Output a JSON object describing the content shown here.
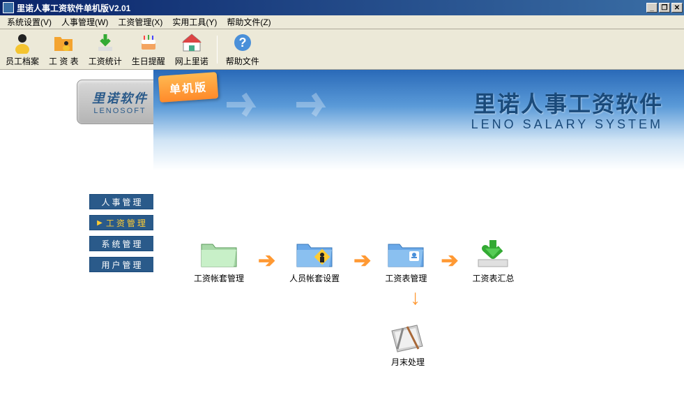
{
  "titlebar": {
    "title": "里诺人事工资软件单机版V2.01"
  },
  "menubar": {
    "items": [
      "系统设置(V)",
      "人事管理(W)",
      "工资管理(X)",
      "实用工具(Y)",
      "帮助文件(Z)"
    ]
  },
  "toolbar": {
    "items": [
      "员工档案",
      "工 资 表",
      "工资统计",
      "生日提醒",
      "网上里诺",
      "帮助文件"
    ]
  },
  "logo": {
    "cn": "里诺软件",
    "en": "LENOSOFT"
  },
  "nav": {
    "items": [
      "人事管理",
      "工资管理",
      "系统管理",
      "用户管理"
    ],
    "active_index": 1
  },
  "banner": {
    "badge": "单机版",
    "title_cn": "里诺人事工资软件",
    "title_en": "LENO SALARY SYSTEM"
  },
  "flow": {
    "items": [
      "工资帐套管理",
      "人员帐套设置",
      "工资表管理",
      "工资表汇总"
    ],
    "bottom": "月末处理"
  }
}
